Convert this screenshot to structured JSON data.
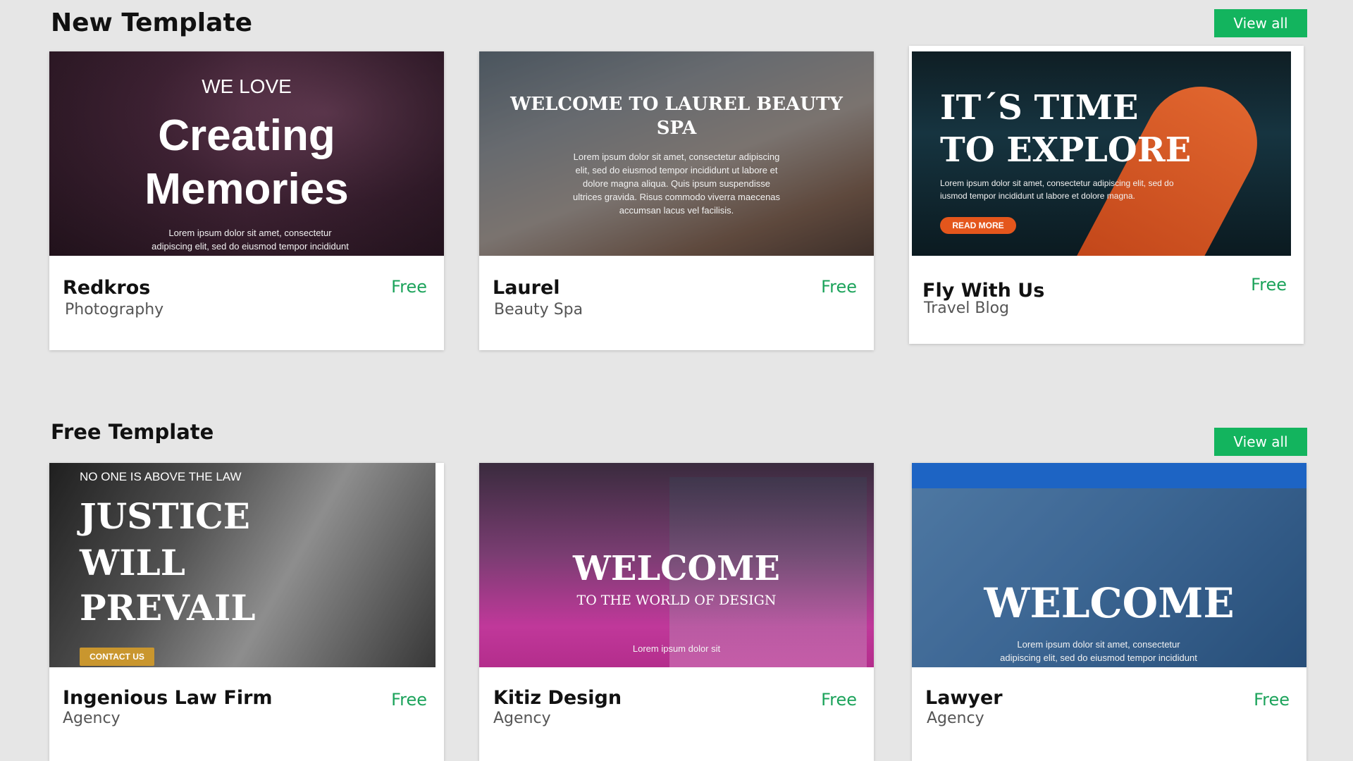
{
  "sections": {
    "new": {
      "title": "New Template",
      "view_all": "View all"
    },
    "free": {
      "title": "Free Template",
      "view_all": "View all"
    }
  },
  "cards": {
    "redkros": {
      "name": "Redkros",
      "category": "Photography",
      "price": "Free",
      "thumb": {
        "kicker": "WE LOVE",
        "headline_1": "Creating",
        "headline_2": "Memories",
        "body": "Lorem ipsum dolor sit amet, consectetur adipiscing elit, sed do eiusmod tempor incididunt ut labore et"
      }
    },
    "laurel": {
      "name": "Laurel",
      "category": "Beauty Spa",
      "price": "Free",
      "thumb": {
        "headline": "WELCOME TO LAUREL BEAUTY SPA",
        "body": "Lorem ipsum dolor sit amet, consectetur adipiscing elit, sed do eiusmod tempor incididunt ut labore et dolore magna aliqua. Quis ipsum suspendisse ultrices gravida. Risus commodo viverra maecenas accumsan lacus vel facilisis."
      }
    },
    "fly": {
      "name": "Fly With Us",
      "category": "Travel Blog",
      "price": "Free",
      "thumb": {
        "headline_1": "IT´S TIME",
        "headline_2": "TO EXPLORE",
        "body": "Lorem ipsum dolor sit amet, consectetur adipiscing elit, sed do iusmod tempor incididunt ut labore et dolore magna.",
        "button": "READ MORE"
      }
    },
    "law": {
      "name": "Ingenious Law Firm",
      "category": "Agency",
      "price": "Free",
      "thumb": {
        "kicker": "NO ONE IS ABOVE THE LAW",
        "headline_1": "JUSTICE",
        "headline_2": "WILL",
        "headline_3": "PREVAIL",
        "button": "CONTACT US"
      }
    },
    "kitiz": {
      "name": "Kitiz Design",
      "category": "Agency",
      "price": "Free",
      "thumb": {
        "headline": "WELCOME",
        "subline": "TO THE WORLD OF DESIGN",
        "body": "Lorem ipsum dolor sit"
      }
    },
    "lawyer": {
      "name": "Lawyer",
      "category": "Agency",
      "price": "Free",
      "thumb": {
        "headline": "WELCOME",
        "body": "Lorem ipsum dolor sit amet, consectetur adipiscing elit, sed do eiusmod tempor incididunt"
      }
    }
  },
  "colors": {
    "accent": "#13b45e",
    "price": "#1ca35b",
    "background": "#e6e6e6"
  }
}
